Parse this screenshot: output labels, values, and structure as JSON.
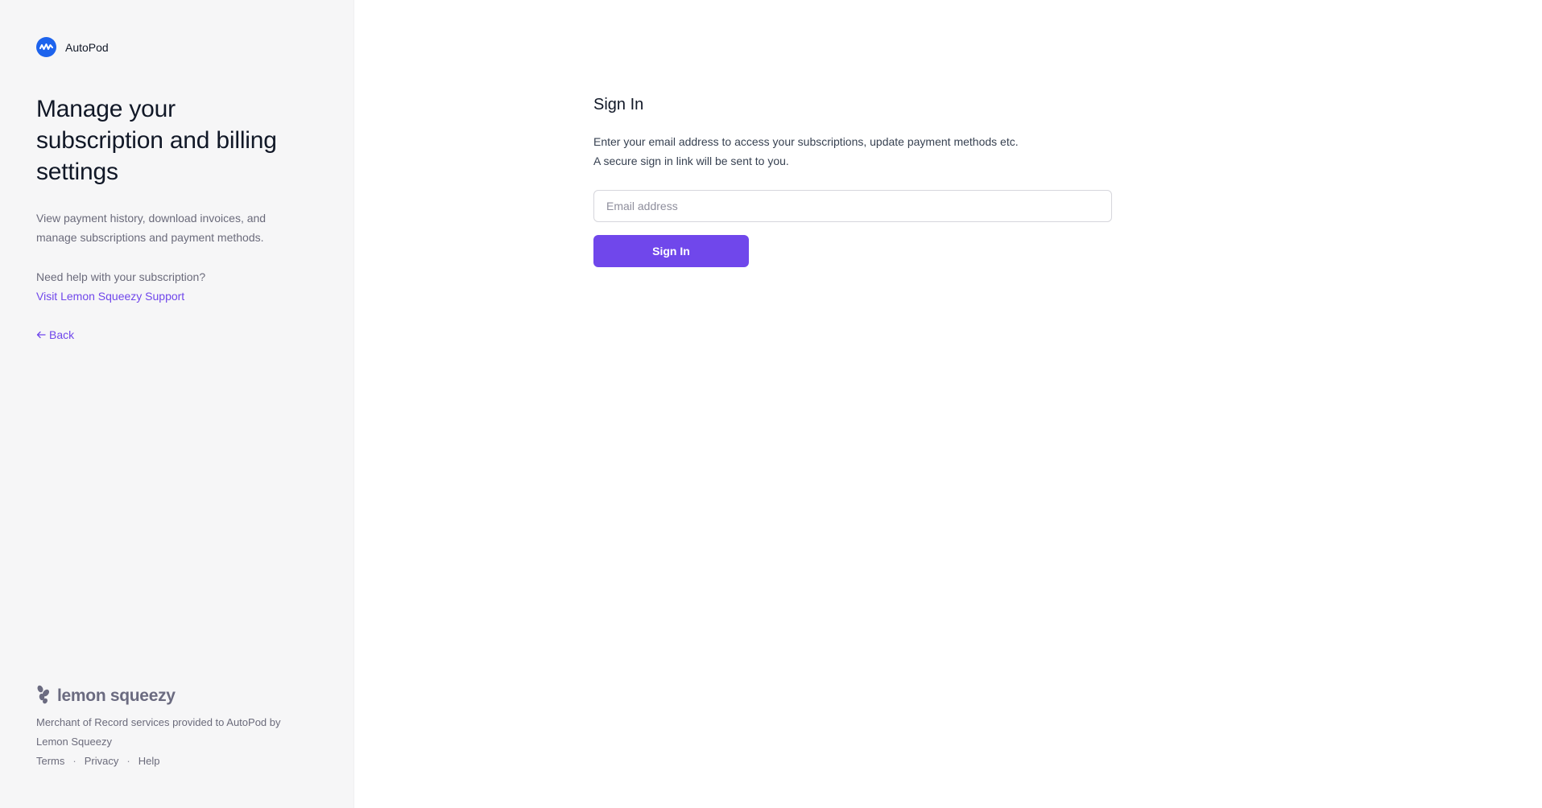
{
  "brand": {
    "name": "AutoPod",
    "logo_color": "#1d63ed"
  },
  "sidebar": {
    "headline": "Manage your subscription and billing settings",
    "lead": "View payment history, download invoices, and manage subscriptions and payment methods.",
    "help_text": "Need help with your subscription?",
    "support_link": "Visit Lemon Squeezy Support",
    "back_link": "Back",
    "back_icon": "arrow-left-icon"
  },
  "footer": {
    "wordmark": "lemon squeezy",
    "merchant_text": "Merchant of Record services provided to AutoPod by Lemon Squeezy",
    "links": {
      "terms": "Terms",
      "privacy": "Privacy",
      "help": "Help",
      "separator": "·"
    }
  },
  "main": {
    "title": "Sign In",
    "description_line1": "Enter your email address to access your subscriptions, update payment methods etc.",
    "description_line2": "A secure sign in link will be sent to you.",
    "email_placeholder": "Email address",
    "email_value": "",
    "button_label": "Sign In"
  },
  "colors": {
    "accent": "#7047eb",
    "sidebar_bg": "#f6f6f7",
    "muted_text": "#6b6b7b"
  }
}
